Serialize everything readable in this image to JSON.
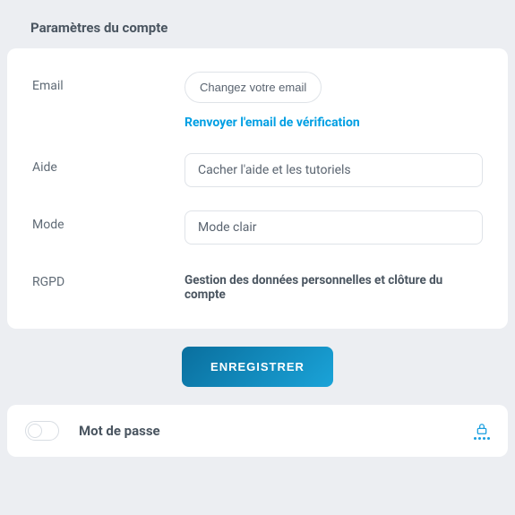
{
  "page": {
    "title": "Paramètres du compte"
  },
  "email": {
    "label": "Email",
    "change_button": "Changez votre email",
    "resend_link": "Renvoyer l'email de vérification"
  },
  "help": {
    "label": "Aide",
    "select_value": "Cacher l'aide et les tutoriels"
  },
  "mode": {
    "label": "Mode",
    "select_value": "Mode clair"
  },
  "gdpr": {
    "label": "RGPD",
    "text": "Gestion des données personnelles et clôture du compte"
  },
  "actions": {
    "save": "ENREGISTRER"
  },
  "password": {
    "title": "Mot de passe"
  }
}
